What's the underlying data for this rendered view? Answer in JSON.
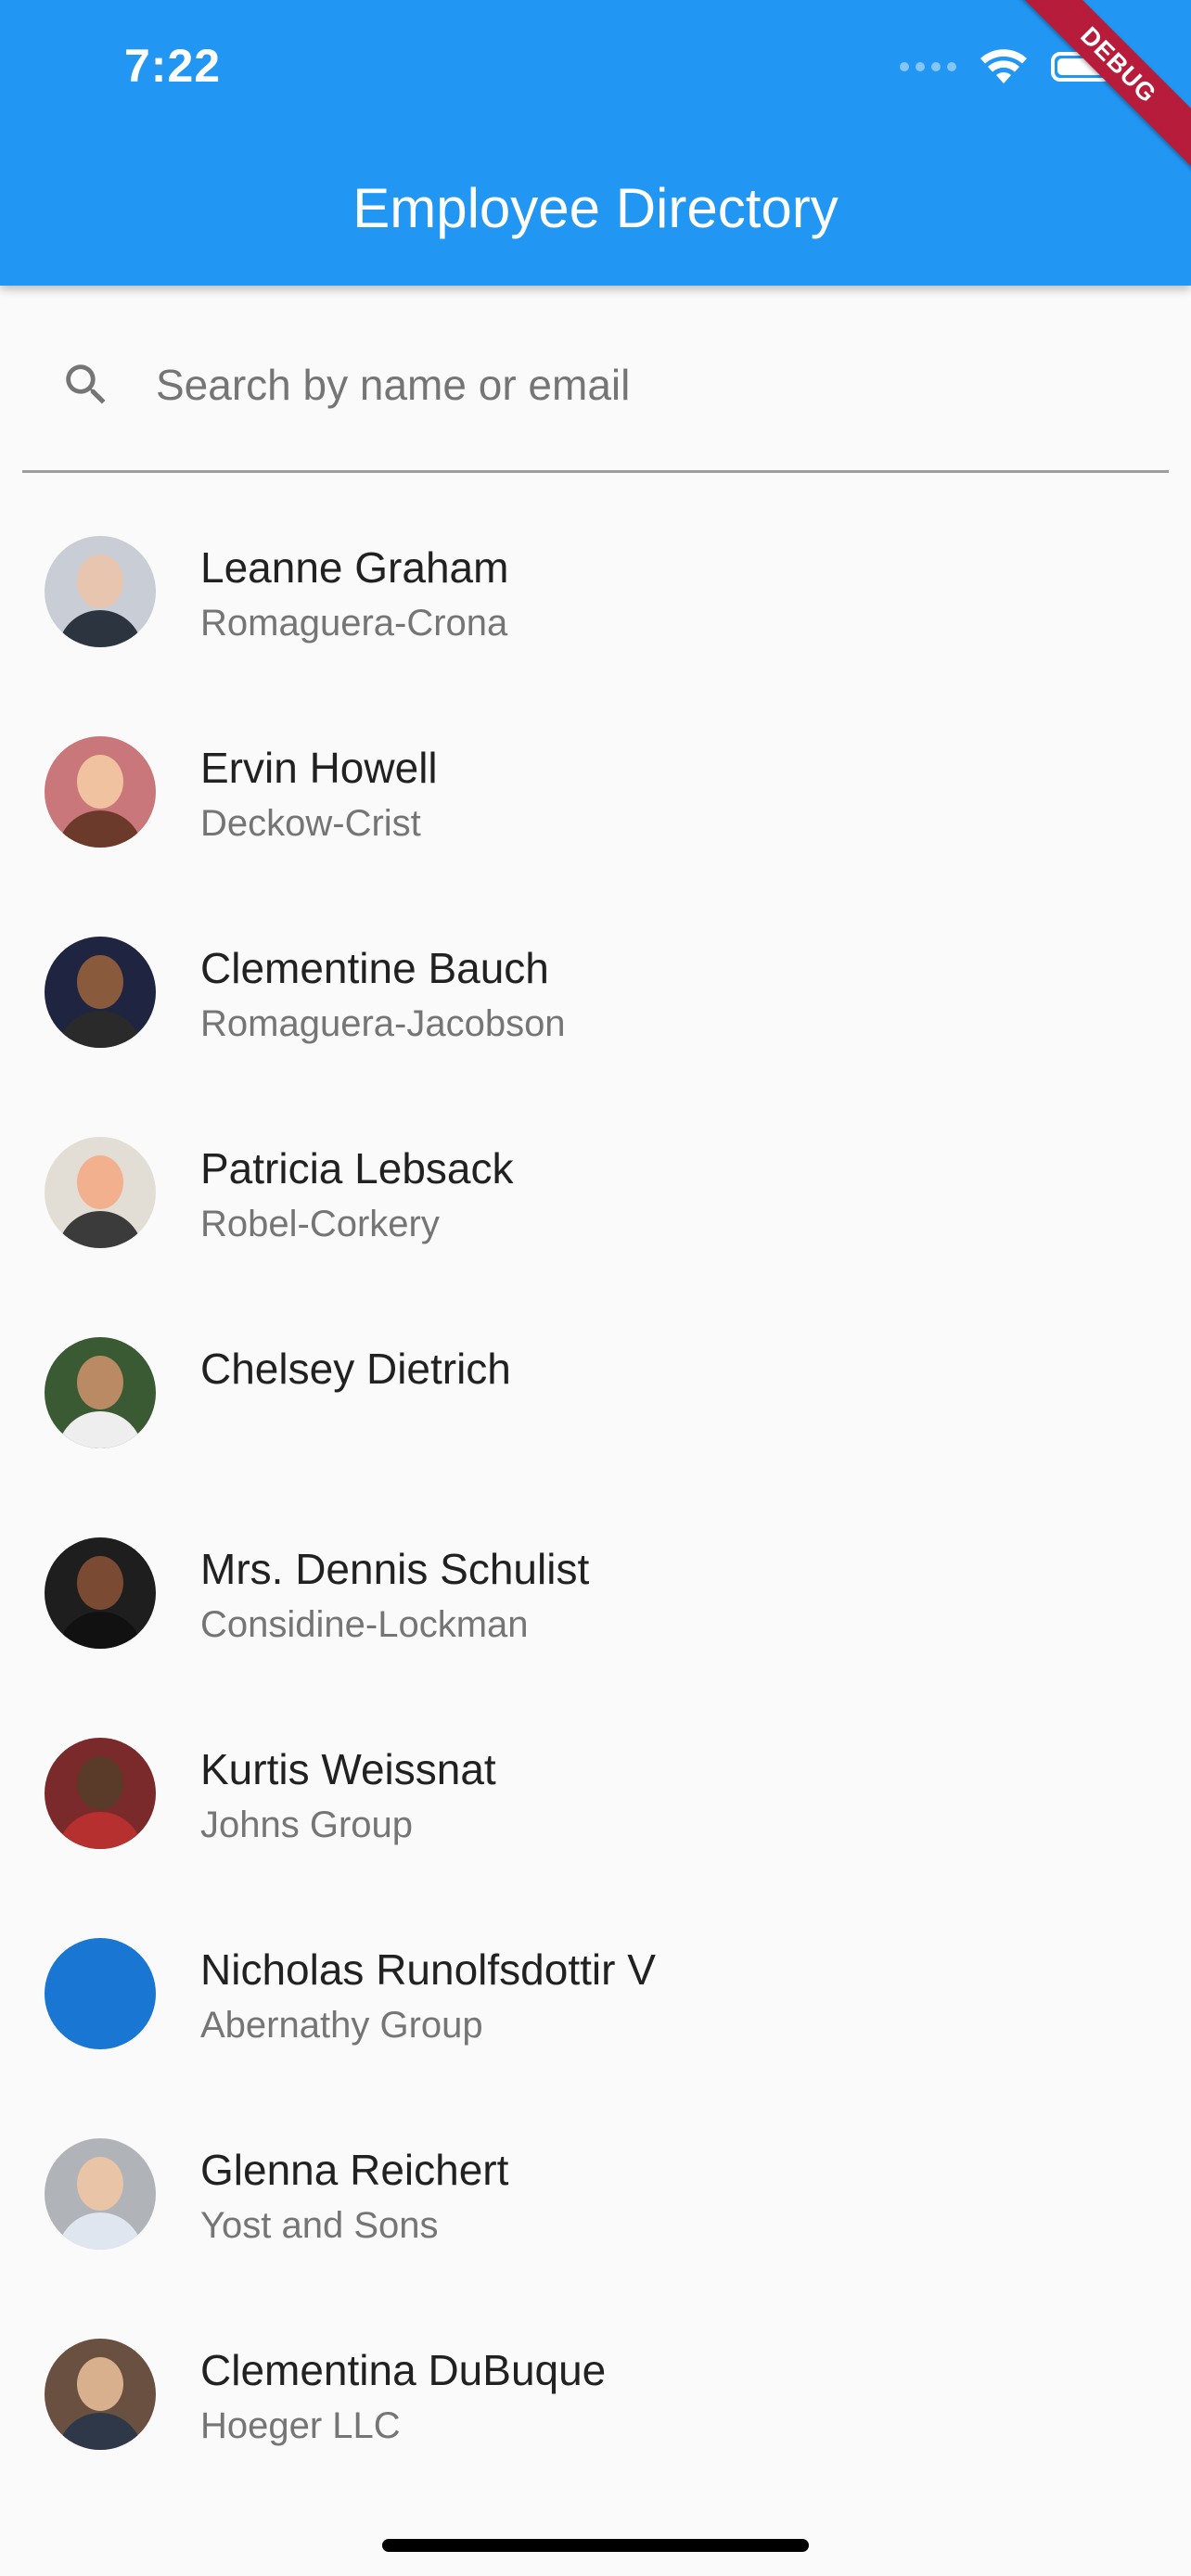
{
  "status_bar": {
    "time": "7:22"
  },
  "debug_banner": "DEBUG",
  "app_bar": {
    "title": "Employee Directory",
    "color": "#2196f3"
  },
  "search": {
    "placeholder": "Search by name or email",
    "value": "",
    "icon": "search-icon"
  },
  "employees": [
    {
      "name": "Leanne Graham",
      "company": "Romaguera-Crona",
      "avatar": "photo"
    },
    {
      "name": "Ervin Howell",
      "company": "Deckow-Crist",
      "avatar": "photo"
    },
    {
      "name": "Clementine Bauch",
      "company": "Romaguera-Jacobson",
      "avatar": "photo"
    },
    {
      "name": "Patricia Lebsack",
      "company": "Robel-Corkery",
      "avatar": "photo"
    },
    {
      "name": "Chelsey Dietrich",
      "company": "",
      "avatar": "photo"
    },
    {
      "name": "Mrs. Dennis Schulist",
      "company": "Considine-Lockman",
      "avatar": "photo"
    },
    {
      "name": "Kurtis Weissnat",
      "company": "Johns Group",
      "avatar": "photo"
    },
    {
      "name": "Nicholas Runolfsdottir V",
      "company": "Abernathy Group",
      "avatar": "placeholder-blue"
    },
    {
      "name": "Glenna Reichert",
      "company": "Yost and Sons",
      "avatar": "photo"
    },
    {
      "name": "Clementina DuBuque",
      "company": "Hoeger LLC",
      "avatar": "photo"
    }
  ]
}
